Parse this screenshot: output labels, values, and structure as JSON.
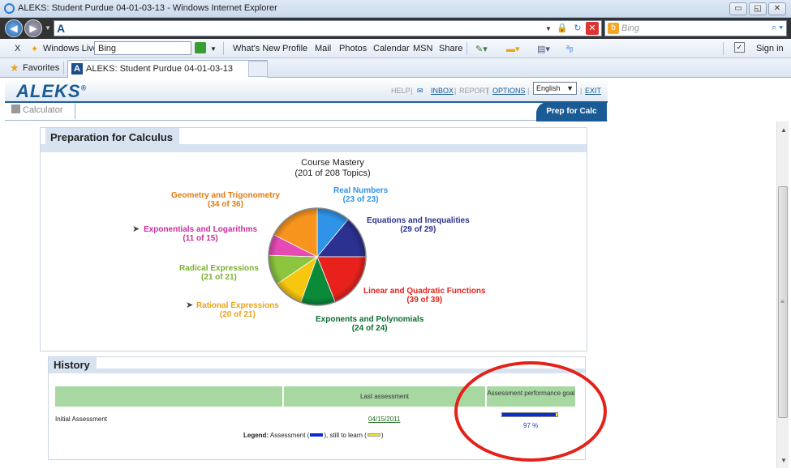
{
  "window": {
    "title": "ALEKS: Student Purdue 04-01-03-13 - Windows Internet Explorer",
    "buttons": [
      "▭",
      "◱",
      "✕"
    ]
  },
  "address_bar": {
    "url_icon_letter": "A",
    "search_placeholder": "Bing",
    "bing_logo": "b"
  },
  "toolbar": {
    "close": "X",
    "windows_live": "Windows Live",
    "bing_field": "Bing",
    "links": [
      "What's New",
      "Profile",
      "Mail",
      "Photos",
      "Calendar",
      "MSN",
      "Share"
    ],
    "sign_in": "Sign in"
  },
  "favorites_bar": {
    "favorites": "Favorites",
    "tab_title": "ALEKS: Student Purdue 04-01-03-13"
  },
  "aleks_header": {
    "logo": "ALEKS",
    "help": "HELP",
    "inbox": "INBOX",
    "report": "REPORT",
    "options": "OPTIONS",
    "language": "English",
    "exit": "EXIT",
    "calculator": "Calculator",
    "course_tab": "Prep for Calc"
  },
  "prep_section": {
    "title": "Preparation for Calculus",
    "mastery_title": "Course Mastery",
    "mastery_count": "(201 of 208 Topics)"
  },
  "pie": {
    "slices": [
      {
        "name": "Real Numbers",
        "count": "(23 of 23)",
        "color": "#2f93e8",
        "fraction": 0.11
      },
      {
        "name": "Equations and Inequalities",
        "count": "(29 of 29)",
        "color": "#2b3190",
        "fraction": 0.14
      },
      {
        "name": "Linear and Quadratic Functions",
        "count": "(39 of 39)",
        "color": "#e8211c",
        "fraction": 0.19
      },
      {
        "name": "Exponents and Polynomials",
        "count": "(24 of 24)",
        "color": "#0b8a3a",
        "fraction": 0.115
      },
      {
        "name": "Rational Expressions",
        "count": "(20 of 21)",
        "color": "#f7c60f",
        "fraction": 0.1
      },
      {
        "name": "Radical Expressions",
        "count": "(21 of 21)",
        "color": "#8cc63f",
        "fraction": 0.1
      },
      {
        "name": "Exponentials and Logarithms",
        "count": "(11 of 15)",
        "color": "#e64ab4",
        "fraction": 0.07
      },
      {
        "name": "Geometry and Trigonometry",
        "count": "(34 of 36)",
        "color": "#f7941d",
        "fraction": 0.175
      }
    ]
  },
  "history": {
    "title": "History",
    "columns": [
      "",
      "Last assessment",
      "Assessment performance goal"
    ],
    "row_label": "Initial Assessment",
    "last_assessment": "04/15/2011",
    "performance_percent": "97 %",
    "performance_value": 0.97,
    "legend_label": "Legend:",
    "legend_assessment": "Assessment (",
    "legend_mid": "),   still to learn (",
    "legend_end": ")"
  }
}
